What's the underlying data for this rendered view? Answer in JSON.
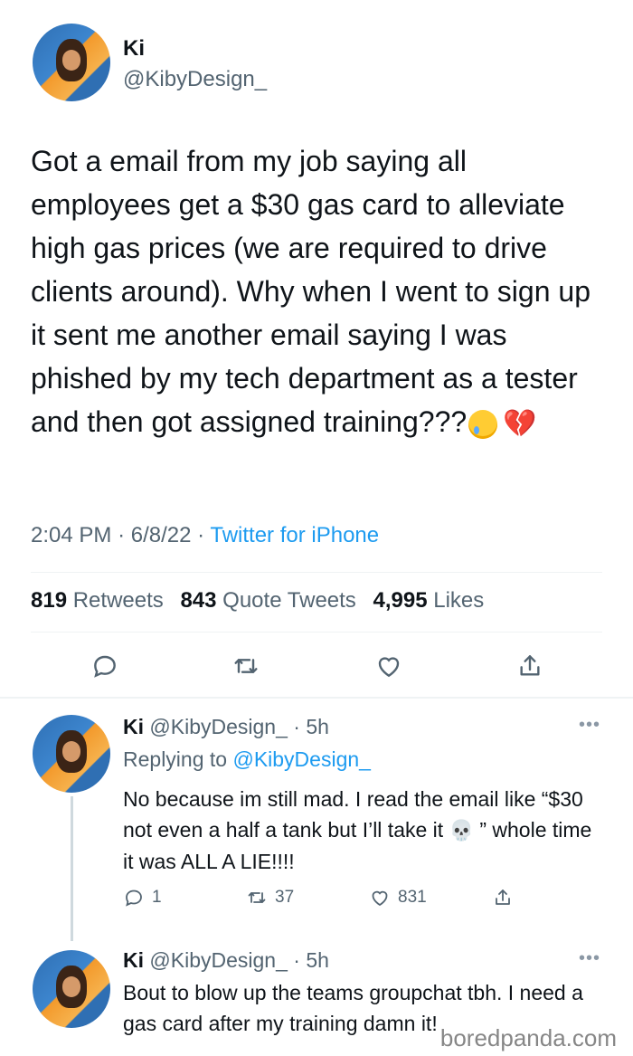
{
  "main_tweet": {
    "name": "Ki",
    "handle": "@KibyDesign_",
    "text": "Got a email from my job saying all employees get a $30 gas card to alleviate high gas prices (we are required to drive clients around). Why when I went to sign up it sent me another email saying I was phished by my tech department as a tester and then got assigned training???",
    "time": "2:04 PM",
    "date": "6/8/22",
    "source": "Twitter for iPhone",
    "retweets_count": "819",
    "retweets_label": "Retweets",
    "quotes_count": "843",
    "quotes_label": "Quote Tweets",
    "likes_count": "4,995",
    "likes_label": "Likes"
  },
  "replies": [
    {
      "name": "Ki",
      "handle": "@KibyDesign_",
      "time": "5h",
      "replying_label": "Replying to",
      "replying_to": "@KibyDesign_",
      "text_before_emoji": "No because im still mad. I read the email like “$30 not even a half a tank but I’ll take it",
      "text_after_emoji": " ” whole time it was ALL A LIE!!!!",
      "reply_count": "1",
      "retweet_count": "37",
      "like_count": "831"
    },
    {
      "name": "Ki",
      "handle": "@KibyDesign_",
      "time": "5h",
      "text": "Bout to blow up the teams groupchat tbh. I need a gas card after my training damn it!"
    }
  ],
  "watermark": "boredpanda.com",
  "colors": {
    "accent": "#1d9bf0",
    "secondary_text": "#536471",
    "heart": "#e0245e"
  },
  "icons": [
    "reply-icon",
    "retweet-icon",
    "like-icon",
    "share-icon",
    "more-icon",
    "crying-face-emoji",
    "broken-heart-emoji",
    "skull-emoji"
  ]
}
